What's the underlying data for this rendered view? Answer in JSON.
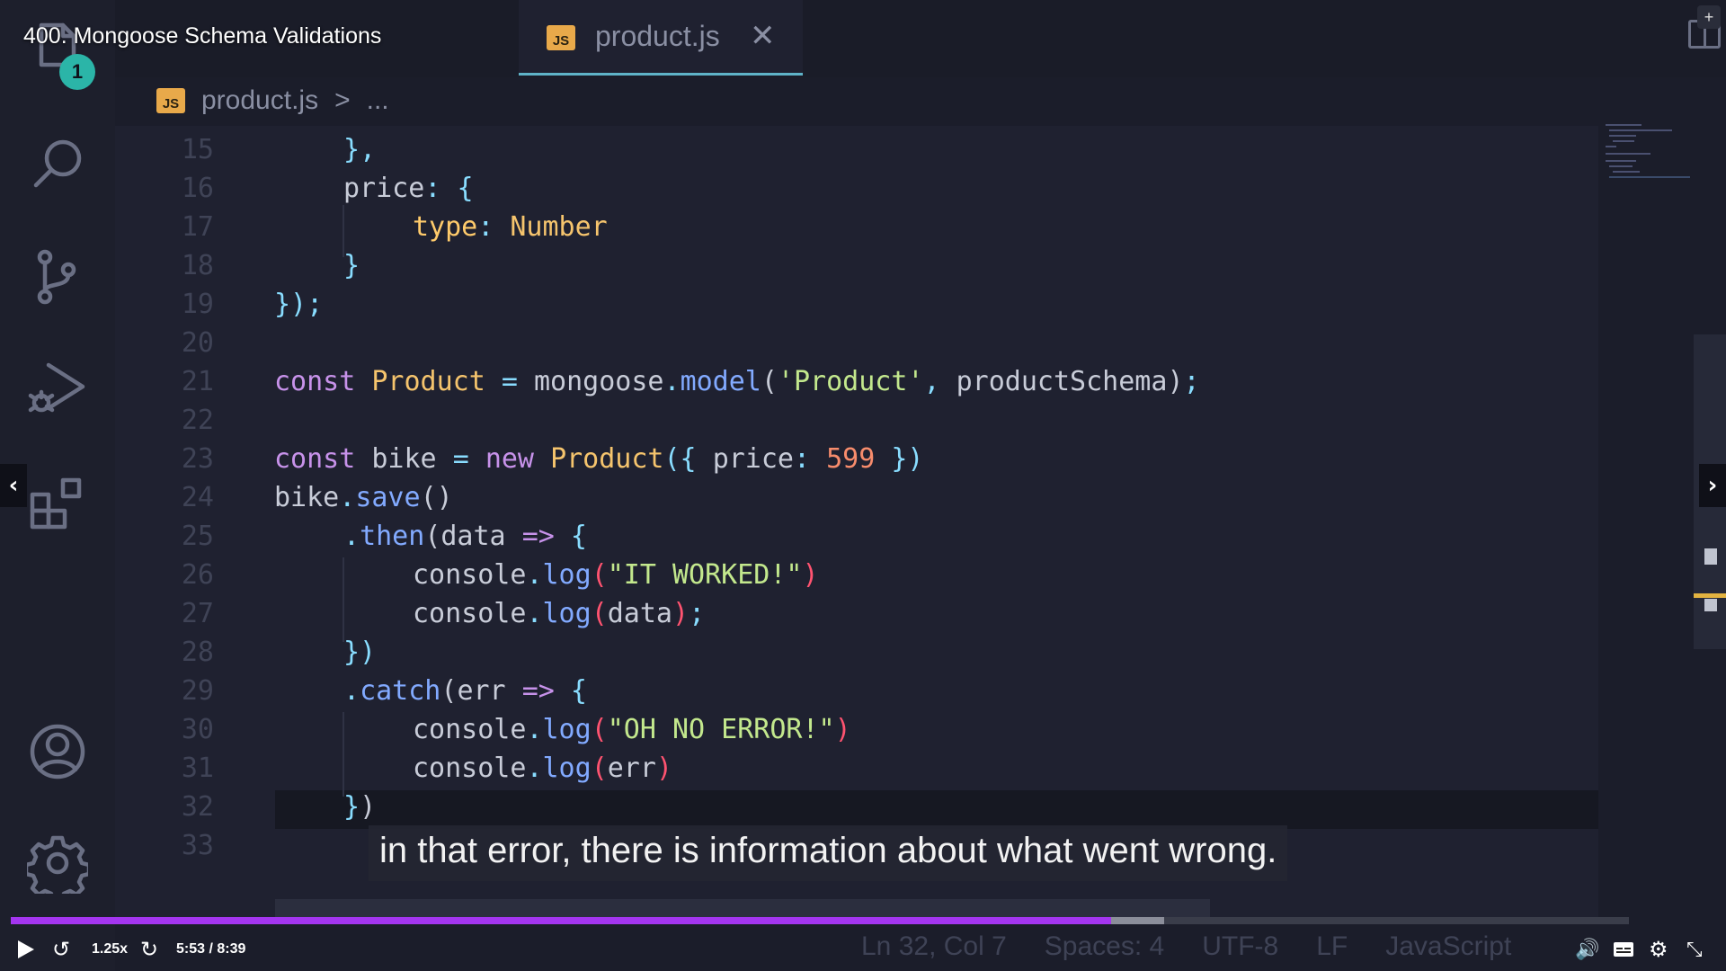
{
  "video": {
    "title": "400. Mongoose Schema Validations",
    "caption": "in that error, there is information about what went wrong.",
    "speed": "1.25x",
    "time": "5:53 / 8:39",
    "progress": 0.68,
    "buffered": 0.713
  },
  "editor": {
    "tab": {
      "badge": "JS",
      "filename": "product.js",
      "close": "✕"
    },
    "breadcrumb": {
      "badge": "JS",
      "file": "product.js",
      "separator": ">",
      "more": "..."
    },
    "notification_badge": "1",
    "line_numbers": [
      "15",
      "16",
      "17",
      "18",
      "19",
      "20",
      "21",
      "22",
      "23",
      "24",
      "25",
      "26",
      "27",
      "28",
      "29",
      "30",
      "31",
      "32",
      "33"
    ],
    "code": {
      "l15": {
        "a": "},",
        "b": ""
      },
      "l16": {
        "key": "price",
        "colon": ":",
        "brace": "{"
      },
      "l17": {
        "key": "type",
        "colon": ":",
        "value": "Number"
      },
      "l18": {
        "brace": "}"
      },
      "l19": {
        "a": "})",
        "b": ";"
      },
      "l21": {
        "kw": "const",
        "name": "Product",
        "eq": "=",
        "obj": "mongoose",
        "dot": ".",
        "fn": "model",
        "open": "(",
        "str": "'Product'",
        "comma": ",",
        "arg": "productSchema",
        "close": ")",
        "semi": ";"
      },
      "l23": {
        "kw": "const",
        "name": "bike",
        "eq": "=",
        "new": "new",
        "cls": "Product",
        "open": "({",
        "key": "price",
        "colon": ":",
        "num": "599",
        "close": "})"
      },
      "l24": {
        "obj": "bike",
        "dot": ".",
        "fn": "save",
        "parens": "()"
      },
      "l25": {
        "dot": ".",
        "fn": "then",
        "open": "(",
        "arg": "data",
        "arrow": "=>",
        "brace": "{"
      },
      "l26": {
        "obj": "console",
        "dot": ".",
        "fn": "log",
        "open": "(",
        "str": "\"IT WORKED!\"",
        "close": ")"
      },
      "l27": {
        "obj": "console",
        "dot": ".",
        "fn": "log",
        "open": "(",
        "arg": "data",
        "close": ")",
        "semi": ";"
      },
      "l28": {
        "brace": "})"
      },
      "l29": {
        "dot": ".",
        "fn": "catch",
        "open": "(",
        "arg": "err",
        "arrow": "=>",
        "brace": "{"
      },
      "l30": {
        "obj": "console",
        "dot": ".",
        "fn": "log",
        "open": "(",
        "str": "\"OH NO ERROR!\"",
        "close": ")"
      },
      "l31": {
        "obj": "console",
        "dot": ".",
        "fn": "log",
        "open": "(",
        "arg": "err",
        "close": ")"
      },
      "l32": {
        "brace": "}",
        "paren": ")"
      }
    },
    "status": {
      "position": "Ln 32, Col 7",
      "spaces": "Spaces: 4",
      "encoding": "UTF-8",
      "eol": "LF",
      "language": "JavaScript"
    }
  },
  "icons": {
    "explorer": "files-icon",
    "search": "search-icon",
    "source_control": "source-control-icon",
    "run": "run-debug-icon",
    "extensions": "extensions-icon",
    "account": "account-icon",
    "settings": "gear-icon"
  },
  "colors": {
    "keyword": "#c792ea",
    "class": "#f5c46d",
    "function": "#82aaff",
    "string": "#c3e88d",
    "number": "#f78c6c",
    "progress": "#a435f0"
  }
}
